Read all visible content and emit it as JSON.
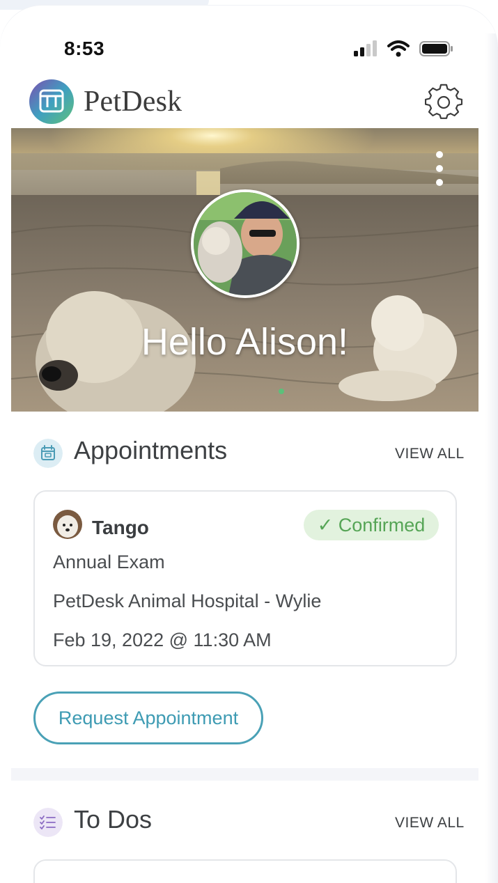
{
  "status_bar": {
    "time": "8:53"
  },
  "header": {
    "brand": "PetDesk"
  },
  "hero": {
    "greeting": "Hello Alison!"
  },
  "appointments": {
    "title": "Appointments",
    "view_all": "VIEW ALL",
    "card": {
      "pet_name": "Tango",
      "status": "✓ Confirmed",
      "type": "Annual Exam",
      "location": "PetDesk Animal Hospital - Wylie",
      "datetime": "Feb 19, 2022 @ 11:30 AM"
    },
    "request_button": "Request Appointment"
  },
  "todos": {
    "title": "To Dos",
    "view_all": "VIEW ALL"
  },
  "colors": {
    "accent": "#4aa1b6",
    "confirmed_bg": "#e2f2de",
    "confirmed_text": "#56a556",
    "appointments_icon_bg": "#dcedf4",
    "todos_icon_bg": "#ece6f6"
  }
}
